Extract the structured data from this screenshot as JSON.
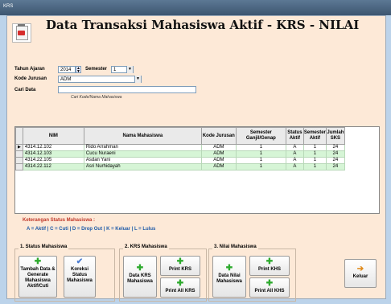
{
  "window": {
    "title": "KRS"
  },
  "header": {
    "title": "Data Transaksi Mahasiswa Aktif - KRS - NILAI"
  },
  "filters": {
    "tahun_label": "Tahun Ajaran",
    "tahun_value": "2014",
    "semester_label": "Semester",
    "semester_value": "1",
    "jurusan_label": "Kode Jurusan",
    "jurusan_value": "ADM",
    "cari_label": "Cari Data",
    "cari_value": "",
    "cari_hint": "Cari Kode/Nama Mahasiswa"
  },
  "table": {
    "columns": [
      "NIM",
      "Nama Mahasiswa",
      "Kode Jurusan",
      "Semester Ganjil/Genap",
      "Status Aktif",
      "Semester Aktif",
      "Jumlah SKS"
    ],
    "rows": [
      [
        "4314.12.102",
        "Rido Arrahman",
        "ADM",
        "1",
        "A",
        "1",
        "24"
      ],
      [
        "4314.12.103",
        "Cucu Nuraeni",
        "ADM",
        "1",
        "A",
        "1",
        "24"
      ],
      [
        "4314.22.105",
        "Asdan Yani",
        "ADM",
        "1",
        "A",
        "1",
        "24"
      ],
      [
        "4314.22.112",
        "Asri Nurhidayah",
        "ADM",
        "1",
        "A",
        "1",
        "24"
      ]
    ]
  },
  "legend": {
    "title": "Keterangan Status Mahasiswa :",
    "items": "A = Aktif   | C = Cuti   | D = Drop Out   | K = Keluar   | L = Lulus"
  },
  "groups": {
    "g1": {
      "title": "1. Status Mahasiswa",
      "b1": [
        "Tambah Data &",
        "Generate",
        "Mahasiswa",
        "Aktif/Cuti"
      ],
      "b2": [
        "Koreksi",
        "Status",
        "Mahasiswa"
      ]
    },
    "g2": {
      "title": "2. KRS Mahasiswa",
      "b1": [
        "Data KRS",
        "Mahasiswa"
      ],
      "b2": "Print KRS",
      "b3": "Print All KRS"
    },
    "g3": {
      "title": "3. Nilai Mahasiswa",
      "b1": [
        "Data Nilai",
        "Mahasiswa"
      ],
      "b2": "Print KHS",
      "b3": "Print All KHS"
    },
    "exit": "Keluar"
  }
}
